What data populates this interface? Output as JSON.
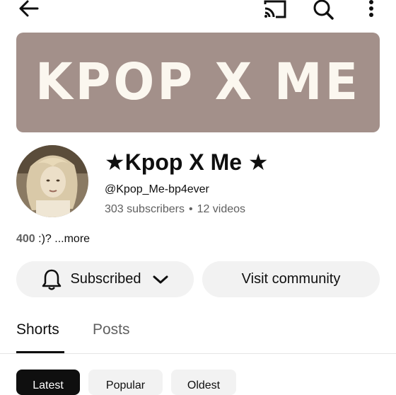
{
  "colors": {
    "banner_bg": "#a3908a",
    "banner_text": "#fbf7ef",
    "pill_bg": "#f2f2f2",
    "chip_active_bg": "#0f0f0f",
    "chip_active_text": "#ffffff",
    "secondary_text": "#606060"
  },
  "header": {
    "back_icon": "arrow-left-icon",
    "cast_icon": "cast-icon",
    "search_icon": "search-icon",
    "more_icon": "more-vert-icon"
  },
  "banner": {
    "text": "KPOP X ME"
  },
  "channel": {
    "title": "★Kpop X Me ★",
    "handle": "@Kpop_Me-bp4ever",
    "subscribers": "303 subscribers",
    "separator": "•",
    "videos": "12 videos"
  },
  "description": {
    "count": "400",
    "text": " :)? ",
    "more": "...more"
  },
  "actions": {
    "subscribed_label": "Subscribed",
    "bell_icon": "bell-icon",
    "chevron_icon": "chevron-down-icon",
    "community_label": "Visit community"
  },
  "tabs": [
    {
      "label": "Shorts",
      "active": true
    },
    {
      "label": "Posts",
      "active": false
    }
  ],
  "chips": [
    {
      "label": "Latest",
      "active": true
    },
    {
      "label": "Popular",
      "active": false
    },
    {
      "label": "Oldest",
      "active": false
    }
  ]
}
